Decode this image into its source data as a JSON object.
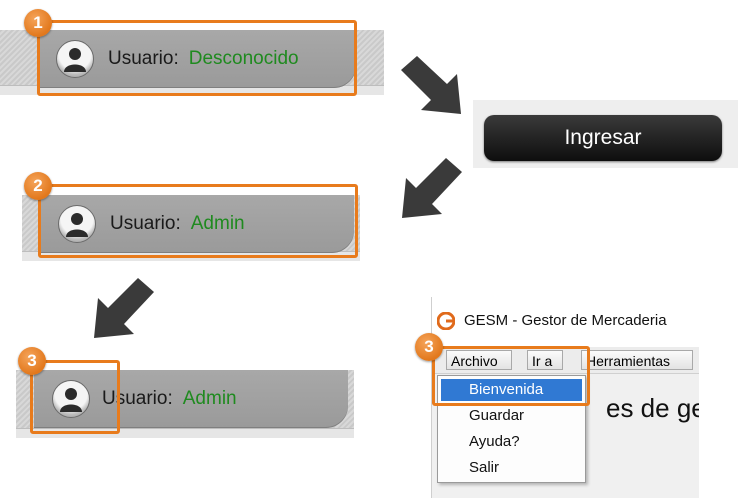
{
  "steps": {
    "one": "1",
    "two": "2",
    "three_a": "3",
    "three_b": "3"
  },
  "panel1": {
    "user_label": "Usuario:",
    "user_value": "Desconocido"
  },
  "panel2": {
    "user_label": "Usuario:",
    "user_value": "Admin"
  },
  "panel3": {
    "user_label": "Usuario:",
    "user_value": "Admin"
  },
  "login": {
    "button_label": "Ingresar"
  },
  "app": {
    "title": "GESM - Gestor de Mercaderia",
    "menu": [
      "Archivo",
      "Ir a",
      "Herramientas"
    ],
    "dropdown": [
      "Bienvenida",
      "Guardar",
      "Ayuda?",
      "Salir"
    ],
    "content_heading": "es de ges"
  },
  "colors": {
    "accent_orange": "#e87b1c",
    "username_green": "#1f8a1f",
    "menu_highlight": "#3079d3"
  }
}
